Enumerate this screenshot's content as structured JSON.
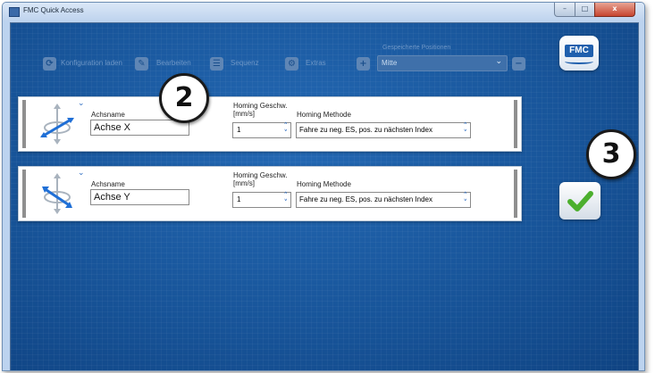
{
  "window": {
    "title": "FMC Quick Access",
    "controls": {
      "minimize": "–",
      "maximize": "□",
      "close": "x"
    }
  },
  "toolbar": {
    "load_config_label": "Konfiguration laden",
    "edit_label": "Bearbeiten",
    "sequence_label": "Sequenz",
    "extras_label": "Extras",
    "saved_positions_label": "Gespeicherte Positionen",
    "saved_positions_value": "Mitte"
  },
  "logo": {
    "text": "FMC"
  },
  "axes": [
    {
      "name_label": "Achsname",
      "name_value": "Achse X",
      "speed_label_1": "Homing Geschw.",
      "speed_label_2": "[mm/s]",
      "speed_value": "1",
      "method_label": "Homing Methode",
      "method_value": "Fahre zu neg. ES, pos. zu nächsten Index"
    },
    {
      "name_label": "Achsname",
      "name_value": "Achse Y",
      "speed_label_1": "Homing Geschw.",
      "speed_label_2": "[mm/s]",
      "speed_value": "1",
      "method_label": "Homing Methode",
      "method_value": "Fahre zu neg. ES, pos. zu nächsten Index"
    }
  ],
  "callouts": {
    "two": "2",
    "three": "3"
  },
  "colors": {
    "background": "#18559a",
    "accent": "#2b6bc1",
    "confirm_check": "#4caf2e",
    "axis_highlight": "#1f6fd6"
  },
  "icons": {
    "load": "refresh-icon",
    "edit": "pencil-icon",
    "sequence": "list-icon",
    "extras": "gear-icon",
    "add": "plus-icon",
    "remove": "minus-icon",
    "confirm": "checkmark-icon"
  }
}
